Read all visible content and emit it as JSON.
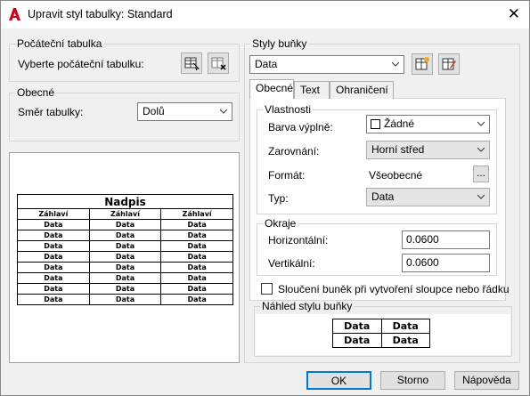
{
  "window": {
    "title": "Upravit styl tabulky: Standard"
  },
  "start_table": {
    "legend": "Počáteční tabulka",
    "label": "Vyberte počáteční tabulku:"
  },
  "general": {
    "legend": "Obecné",
    "direction_label": "Směr tabulky:",
    "direction_value": "Dolů"
  },
  "preview_table": {
    "title": "Nadpis",
    "headers": [
      "Záhlaví",
      "Záhlaví",
      "Záhlaví"
    ],
    "cell": "Data",
    "rows": 8
  },
  "cell_styles": {
    "legend": "Styly buňky",
    "selected": "Data"
  },
  "tabs": [
    "Obecné",
    "Text",
    "Ohraničení"
  ],
  "properties": {
    "legend": "Vlastnosti",
    "fill_label": "Barva výplně:",
    "fill_value": "Žádné",
    "align_label": "Zarovnání:",
    "align_value": "Horní střed",
    "format_label": "Formát:",
    "format_value": "Všeobecné",
    "format_btn": "...",
    "type_label": "Typ:",
    "type_value": "Data"
  },
  "margins": {
    "legend": "Okraje",
    "horizontal_label": "Horizontální:",
    "horizontal_value": "0.0600",
    "vertical_label": "Vertikální:",
    "vertical_value": "0.0600"
  },
  "merge_label": "Sloučení buněk při vytvoření sloupce nebo řádku",
  "cell_preview": {
    "legend": "Náhled stylu buňky",
    "cell": "Data"
  },
  "buttons": {
    "ok": "OK",
    "cancel": "Storno",
    "help": "Nápověda"
  }
}
